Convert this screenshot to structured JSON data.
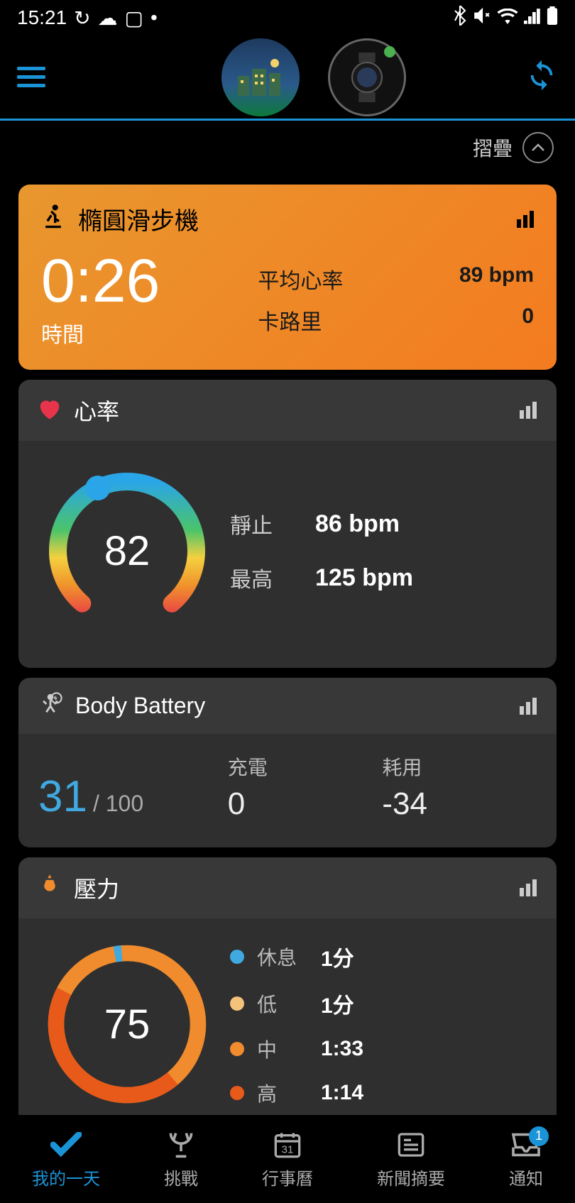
{
  "status": {
    "time": "15:21"
  },
  "collapse": {
    "label": "摺疊"
  },
  "activity": {
    "title": "橢圓滑步機",
    "time_value": "0:26",
    "time_label": "時間",
    "rows": [
      {
        "label": "平均心率",
        "value": "89 bpm"
      },
      {
        "label": "卡路里",
        "value": "0"
      }
    ]
  },
  "heart_rate": {
    "title": "心率",
    "current": "82",
    "stats": [
      {
        "label": "靜止",
        "value": "86 bpm"
      },
      {
        "label": "最高",
        "value": "125 bpm"
      }
    ]
  },
  "body_battery": {
    "title": "Body Battery",
    "value": "31",
    "max_label": "/ 100",
    "cols": [
      {
        "label": "充電",
        "value": "0"
      },
      {
        "label": "耗用",
        "value": "-34"
      }
    ]
  },
  "stress": {
    "title": "壓力",
    "value": "75",
    "rows": [
      {
        "color": "#3fa9e0",
        "label": "休息",
        "value": "1分"
      },
      {
        "color": "#f4c27a",
        "label": "低",
        "value": "1分"
      },
      {
        "color": "#f08b2e",
        "label": "中",
        "value": "1:33"
      },
      {
        "color": "#e85a1a",
        "label": "高",
        "value": "1:14"
      }
    ]
  },
  "nav": {
    "items": [
      {
        "label": "我的一天"
      },
      {
        "label": "挑戰"
      },
      {
        "label": "行事曆"
      },
      {
        "label": "新聞摘要"
      },
      {
        "label": "通知",
        "badge": "1"
      }
    ]
  }
}
